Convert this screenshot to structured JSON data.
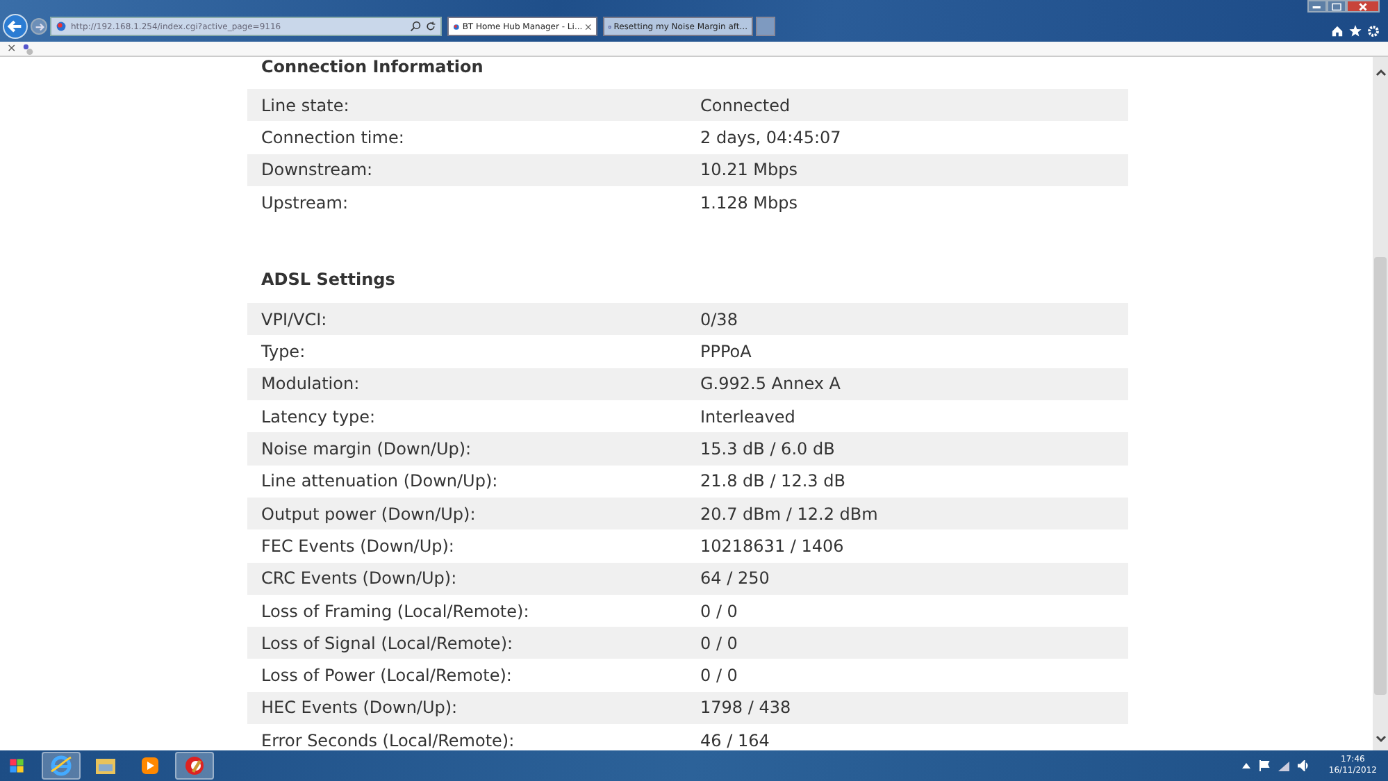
{
  "browser": {
    "url": "http://192.168.1.254/index.cgi?active_page=9116",
    "tabs": [
      {
        "title": "BT Home Hub Manager - Li...",
        "selected": true,
        "closable": true,
        "kind": "ie"
      },
      {
        "title": "Resetting my Noise Margin aft...",
        "selected": false,
        "closable": false,
        "kind": "bt"
      }
    ],
    "command_bar": {
      "close": "×"
    }
  },
  "sections": [
    {
      "title": "Connection Information",
      "rows": [
        {
          "label": "Line state:",
          "value": "Connected"
        },
        {
          "label": "Connection time:",
          "value": "2 days, 04:45:07"
        },
        {
          "label": "Downstream:",
          "value": "10.21 Mbps"
        },
        {
          "label": "Upstream:",
          "value": "1.128 Mbps"
        }
      ]
    },
    {
      "title": "ADSL Settings",
      "rows": [
        {
          "label": "VPI/VCI:",
          "value": "0/38"
        },
        {
          "label": "Type:",
          "value": "PPPoA"
        },
        {
          "label": "Modulation:",
          "value": "G.992.5 Annex A"
        },
        {
          "label": "Latency type:",
          "value": "Interleaved"
        },
        {
          "label": "Noise margin (Down/Up):",
          "value": "15.3 dB / 6.0 dB"
        },
        {
          "label": "Line attenuation (Down/Up):",
          "value": "21.8 dB / 12.3 dB"
        },
        {
          "label": "Output power (Down/Up):",
          "value": "20.7 dBm / 12.2 dBm"
        },
        {
          "label": "FEC Events (Down/Up):",
          "value": "10218631 / 1406"
        },
        {
          "label": "CRC Events (Down/Up):",
          "value": "64 / 250"
        },
        {
          "label": "Loss of Framing (Local/Remote):",
          "value": "0 / 0"
        },
        {
          "label": "Loss of Signal (Local/Remote):",
          "value": "0 / 0"
        },
        {
          "label": "Loss of Power (Local/Remote):",
          "value": "0 / 0"
        },
        {
          "label": "HEC Events (Down/Up):",
          "value": "1798 / 438"
        },
        {
          "label": "Error Seconds (Local/Remote):",
          "value": "46 / 164"
        }
      ]
    }
  ],
  "taskbar": {
    "apps": [
      {
        "kind": "ie",
        "active": true
      },
      {
        "kind": "folder",
        "active": false
      },
      {
        "kind": "media",
        "active": false
      },
      {
        "kind": "ccleaner",
        "active": true
      }
    ],
    "time": "17:46",
    "date": "16/11/2012"
  }
}
